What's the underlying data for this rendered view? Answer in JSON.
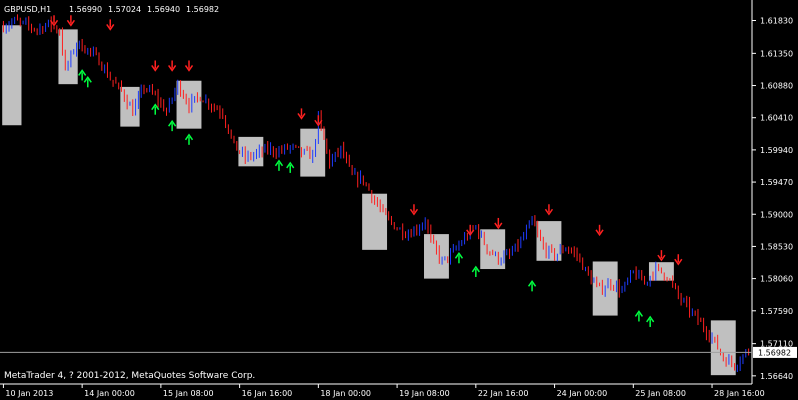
{
  "header": {
    "symbol": "GBPUSD,H1",
    "open": "1.56990",
    "high": "1.57024",
    "low": "1.56940",
    "close": "1.56982"
  },
  "footer": {
    "copyright": "MetaTrader 4, ? 2001-2012, MetaQuotes Software Corp."
  },
  "current_price_label": "1.56982",
  "colors": {
    "background": "#000000",
    "axis": "#ffffff",
    "bar_up": "#1e3cff",
    "bar_down": "#ff2020",
    "box": "#c0c0c0",
    "arrow_down": "#ff2020",
    "arrow_up": "#00ff40"
  },
  "chart_data": {
    "type": "ohlc",
    "ylim": [
      1.5655,
      1.621
    ],
    "y_ticks": [
      "1.61830",
      "1.61350",
      "1.60880",
      "1.60410",
      "1.59940",
      "1.59470",
      "1.59000",
      "1.58530",
      "1.58060",
      "1.57590",
      "1.57110",
      "1.56640"
    ],
    "x_ticks": [
      "10 Jan 2013",
      "14 Jan 00:00",
      "15 Jan 08:00",
      "16 Jan 16:00",
      "18 Jan 00:00",
      "19 Jan 08:00",
      "22 Jan 16:00",
      "24 Jan 00:00",
      "25 Jan 08:00",
      "28 Jan 16:00"
    ],
    "x_tick_index": [
      0,
      28,
      56,
      84,
      112,
      140,
      168,
      196,
      224,
      252
    ],
    "n_bars": 266,
    "price_path": [
      [
        0,
        1.6175
      ],
      [
        4,
        1.6182
      ],
      [
        8,
        1.6176
      ],
      [
        12,
        1.617
      ],
      [
        16,
        1.6178
      ],
      [
        20,
        1.6168
      ],
      [
        22,
        1.611
      ],
      [
        26,
        1.615
      ],
      [
        30,
        1.614
      ],
      [
        34,
        1.6125
      ],
      [
        38,
        1.6098
      ],
      [
        42,
        1.608
      ],
      [
        46,
        1.605
      ],
      [
        50,
        1.6086
      ],
      [
        54,
        1.6072
      ],
      [
        58,
        1.605
      ],
      [
        62,
        1.609
      ],
      [
        66,
        1.606
      ],
      [
        70,
        1.6072
      ],
      [
        74,
        1.606
      ],
      [
        78,
        1.6048
      ],
      [
        82,
        1.6
      ],
      [
        86,
        1.5982
      ],
      [
        90,
        1.5988
      ],
      [
        94,
        1.5995
      ],
      [
        98,
        1.5992
      ],
      [
        102,
        1.5998
      ],
      [
        106,
        1.599
      ],
      [
        110,
        1.5985
      ],
      [
        112,
        1.604
      ],
      [
        116,
        1.5975
      ],
      [
        120,
        1.5995
      ],
      [
        124,
        1.5955
      ],
      [
        128,
        1.595
      ],
      [
        132,
        1.592
      ],
      [
        136,
        1.5895
      ],
      [
        140,
        1.588
      ],
      [
        144,
        1.5872
      ],
      [
        148,
        1.5882
      ],
      [
        150,
        1.5892
      ],
      [
        152,
        1.586
      ],
      [
        156,
        1.583
      ],
      [
        160,
        1.5845
      ],
      [
        164,
        1.5865
      ],
      [
        168,
        1.5882
      ],
      [
        172,
        1.585
      ],
      [
        176,
        1.5835
      ],
      [
        180,
        1.584
      ],
      [
        184,
        1.586
      ],
      [
        188,
        1.589
      ],
      [
        192,
        1.585
      ],
      [
        196,
        1.584
      ],
      [
        200,
        1.5852
      ],
      [
        204,
        1.584
      ],
      [
        208,
        1.581
      ],
      [
        212,
        1.579
      ],
      [
        216,
        1.58
      ],
      [
        220,
        1.5788
      ],
      [
        224,
        1.5815
      ],
      [
        228,
        1.58
      ],
      [
        232,
        1.582
      ],
      [
        236,
        1.581
      ],
      [
        240,
        1.578
      ],
      [
        244,
        1.576
      ],
      [
        248,
        1.574
      ],
      [
        252,
        1.572
      ],
      [
        256,
        1.569
      ],
      [
        260,
        1.568
      ],
      [
        264,
        1.5698
      ],
      [
        265,
        1.5698
      ]
    ],
    "boxes": [
      {
        "from": 0,
        "to": 6,
        "high": 1.6176,
        "low": 1.603
      },
      {
        "from": 20,
        "to": 26,
        "high": 1.617,
        "low": 1.609
      },
      {
        "from": 42,
        "to": 48,
        "high": 1.6086,
        "low": 1.6028
      },
      {
        "from": 62,
        "to": 70,
        "high": 1.6095,
        "low": 1.6025
      },
      {
        "from": 84,
        "to": 92,
        "high": 1.6013,
        "low": 1.597
      },
      {
        "from": 106,
        "to": 114,
        "high": 1.6025,
        "low": 1.5955
      },
      {
        "from": 128,
        "to": 136,
        "high": 1.593,
        "low": 1.5848
      },
      {
        "from": 150,
        "to": 158,
        "high": 1.5871,
        "low": 1.5806
      },
      {
        "from": 170,
        "to": 178,
        "high": 1.5878,
        "low": 1.582
      },
      {
        "from": 190,
        "to": 198,
        "high": 1.589,
        "low": 1.5832
      },
      {
        "from": 210,
        "to": 218,
        "high": 1.5831,
        "low": 1.5752
      },
      {
        "from": 230,
        "to": 238,
        "high": 1.583,
        "low": 1.5803
      },
      {
        "from": 252,
        "to": 260,
        "high": 1.5745,
        "low": 1.5665
      }
    ],
    "arrows_down": [
      [
        18,
        1.6176
      ],
      [
        24,
        1.6176
      ],
      [
        38,
        1.617
      ],
      [
        54,
        1.611
      ],
      [
        60,
        1.611
      ],
      [
        66,
        1.611
      ],
      [
        106,
        1.604
      ],
      [
        112,
        1.603
      ],
      [
        146,
        1.59
      ],
      [
        166,
        1.587
      ],
      [
        176,
        1.588
      ],
      [
        194,
        1.59
      ],
      [
        212,
        1.587
      ],
      [
        234,
        1.5833
      ],
      [
        240,
        1.5827
      ]
    ],
    "arrows_up": [
      [
        30,
        1.61
      ],
      [
        28,
        1.611
      ],
      [
        54,
        1.606
      ],
      [
        60,
        1.6036
      ],
      [
        66,
        1.6016
      ],
      [
        102,
        1.5975
      ],
      [
        98,
        1.5978
      ],
      [
        162,
        1.5843
      ],
      [
        168,
        1.5823
      ],
      [
        188,
        1.5802
      ],
      [
        226,
        1.5758
      ],
      [
        230,
        1.575
      ]
    ]
  }
}
